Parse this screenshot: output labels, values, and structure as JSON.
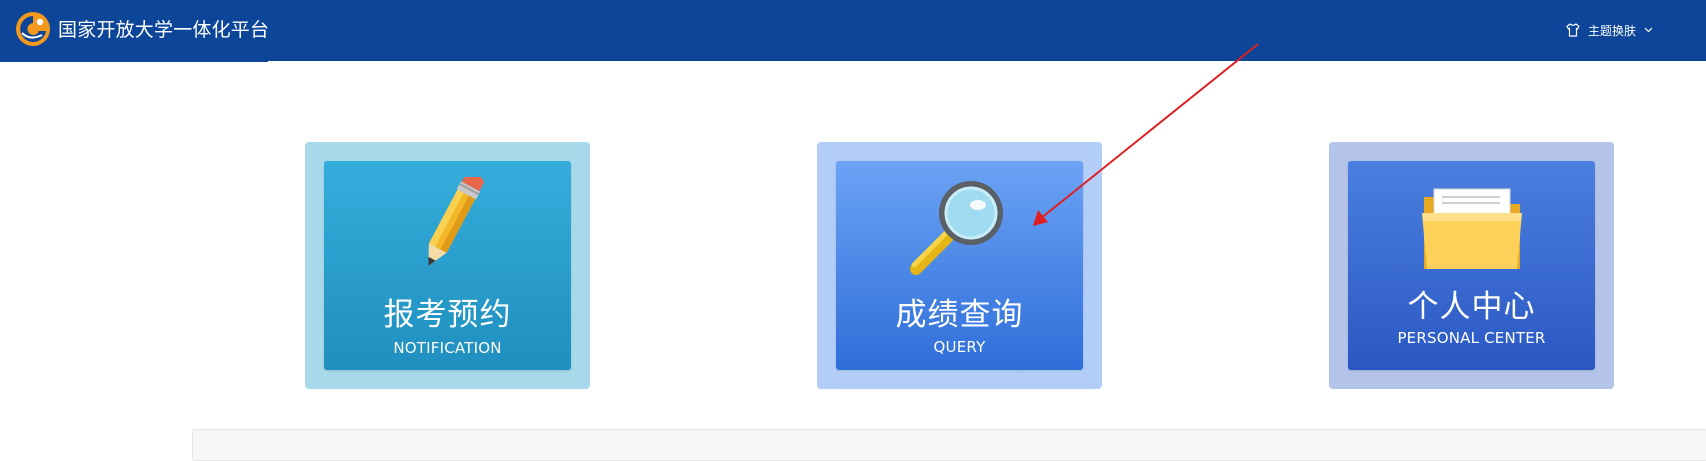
{
  "header": {
    "title": "国家开放大学一体化平台",
    "theme_label": "主题换肤",
    "icons": [
      "logo-icon",
      "shirt-icon",
      "chevron-down-icon"
    ]
  },
  "cards": [
    {
      "id": "notify",
      "title": "报考预约",
      "subtitle": "NOTIFICATION",
      "icon": "pencil-icon"
    },
    {
      "id": "query",
      "title": "成绩查询",
      "subtitle": "QUERY",
      "icon": "magnifier-icon"
    },
    {
      "id": "personal",
      "title": "个人中心",
      "subtitle": "PERSONAL CENTER",
      "icon": "folder-icon"
    }
  ],
  "colors": {
    "header": "#0d4699",
    "annotation_arrow": "#e02020",
    "notify_card": "#35addc",
    "query_card": "#6ba3f5",
    "personal_card": "#4b7fe0"
  }
}
